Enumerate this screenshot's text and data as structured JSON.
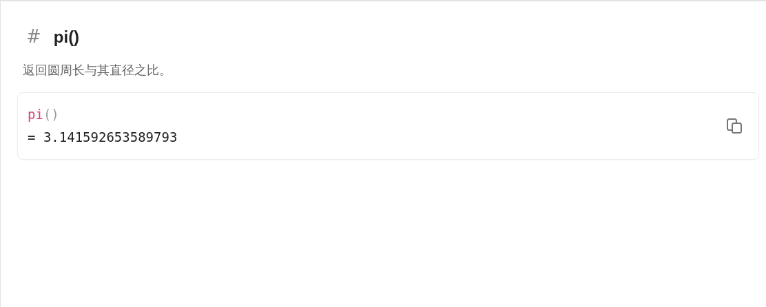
{
  "heading": {
    "marker": "#",
    "title": "pi()"
  },
  "description": "返回圆周长与其直径之比。",
  "code_block": {
    "tokens": [
      {
        "kind": "function",
        "text": "pi"
      },
      {
        "kind": "punctuation",
        "text": "()"
      }
    ],
    "result": "= 3.141592653589793"
  }
}
